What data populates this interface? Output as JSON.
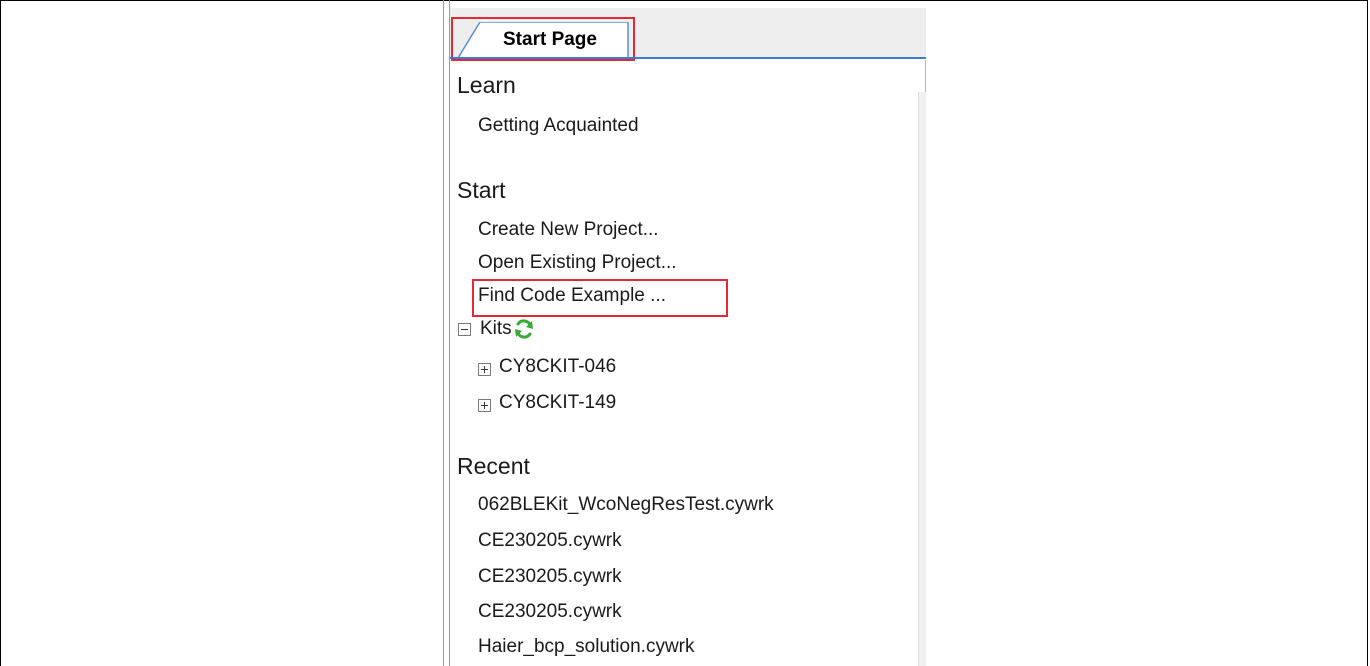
{
  "tab": {
    "label": "Start Page"
  },
  "learn": {
    "heading": "Learn",
    "items": [
      "Getting Acquainted"
    ]
  },
  "start": {
    "heading": "Start",
    "items": [
      "Create New Project...",
      "Open Existing Project...",
      "Find Code Example ..."
    ]
  },
  "kits": {
    "label": "Kits",
    "items": [
      "CY8CKIT-046",
      "CY8CKIT-149"
    ]
  },
  "recent": {
    "heading": "Recent",
    "items": [
      "062BLEKit_WcoNegResTest.cywrk",
      "CE230205.cywrk",
      "CE230205.cywrk",
      "CE230205.cywrk",
      "Haier_bcp_solution.cywrk"
    ]
  },
  "colors": {
    "highlight": "#e02a35",
    "tab_accent": "#3b7bd4",
    "refresh_icon": "#3aaa35"
  }
}
